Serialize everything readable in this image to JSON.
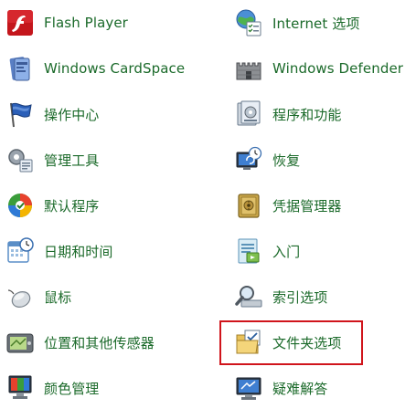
{
  "control_panel": {
    "left_items": [
      {
        "label": "Flash Player",
        "icon": "flash-player-icon"
      },
      {
        "label": "Windows CardSpace",
        "icon": "cardspace-icon"
      },
      {
        "label": "操作中心",
        "icon": "action-center-flag-icon"
      },
      {
        "label": "管理工具",
        "icon": "admin-tools-icon"
      },
      {
        "label": "默认程序",
        "icon": "default-programs-icon"
      },
      {
        "label": "日期和时间",
        "icon": "calendar-clock-icon"
      },
      {
        "label": "鼠标",
        "icon": "mouse-icon"
      },
      {
        "label": "位置和其他传感器",
        "icon": "location-sensor-icon"
      },
      {
        "label": "颜色管理",
        "icon": "color-management-icon"
      }
    ],
    "right_items": [
      {
        "label": "Internet 选项",
        "icon": "internet-options-icon"
      },
      {
        "label": "Windows Defender",
        "icon": "defender-castle-icon"
      },
      {
        "label": "程序和功能",
        "icon": "programs-features-icon"
      },
      {
        "label": "恢复",
        "icon": "recovery-icon"
      },
      {
        "label": "凭据管理器",
        "icon": "credential-vault-icon"
      },
      {
        "label": "入门",
        "icon": "getting-started-icon"
      },
      {
        "label": "索引选项",
        "icon": "indexing-search-icon"
      },
      {
        "label": "文件夹选项",
        "icon": "folder-options-icon"
      },
      {
        "label": "疑难解答",
        "icon": "troubleshooting-icon"
      }
    ]
  },
  "highlight": {
    "target": "文件夹选项",
    "color": "#d0141b"
  },
  "colors": {
    "label_text": "#1b6a2a"
  }
}
